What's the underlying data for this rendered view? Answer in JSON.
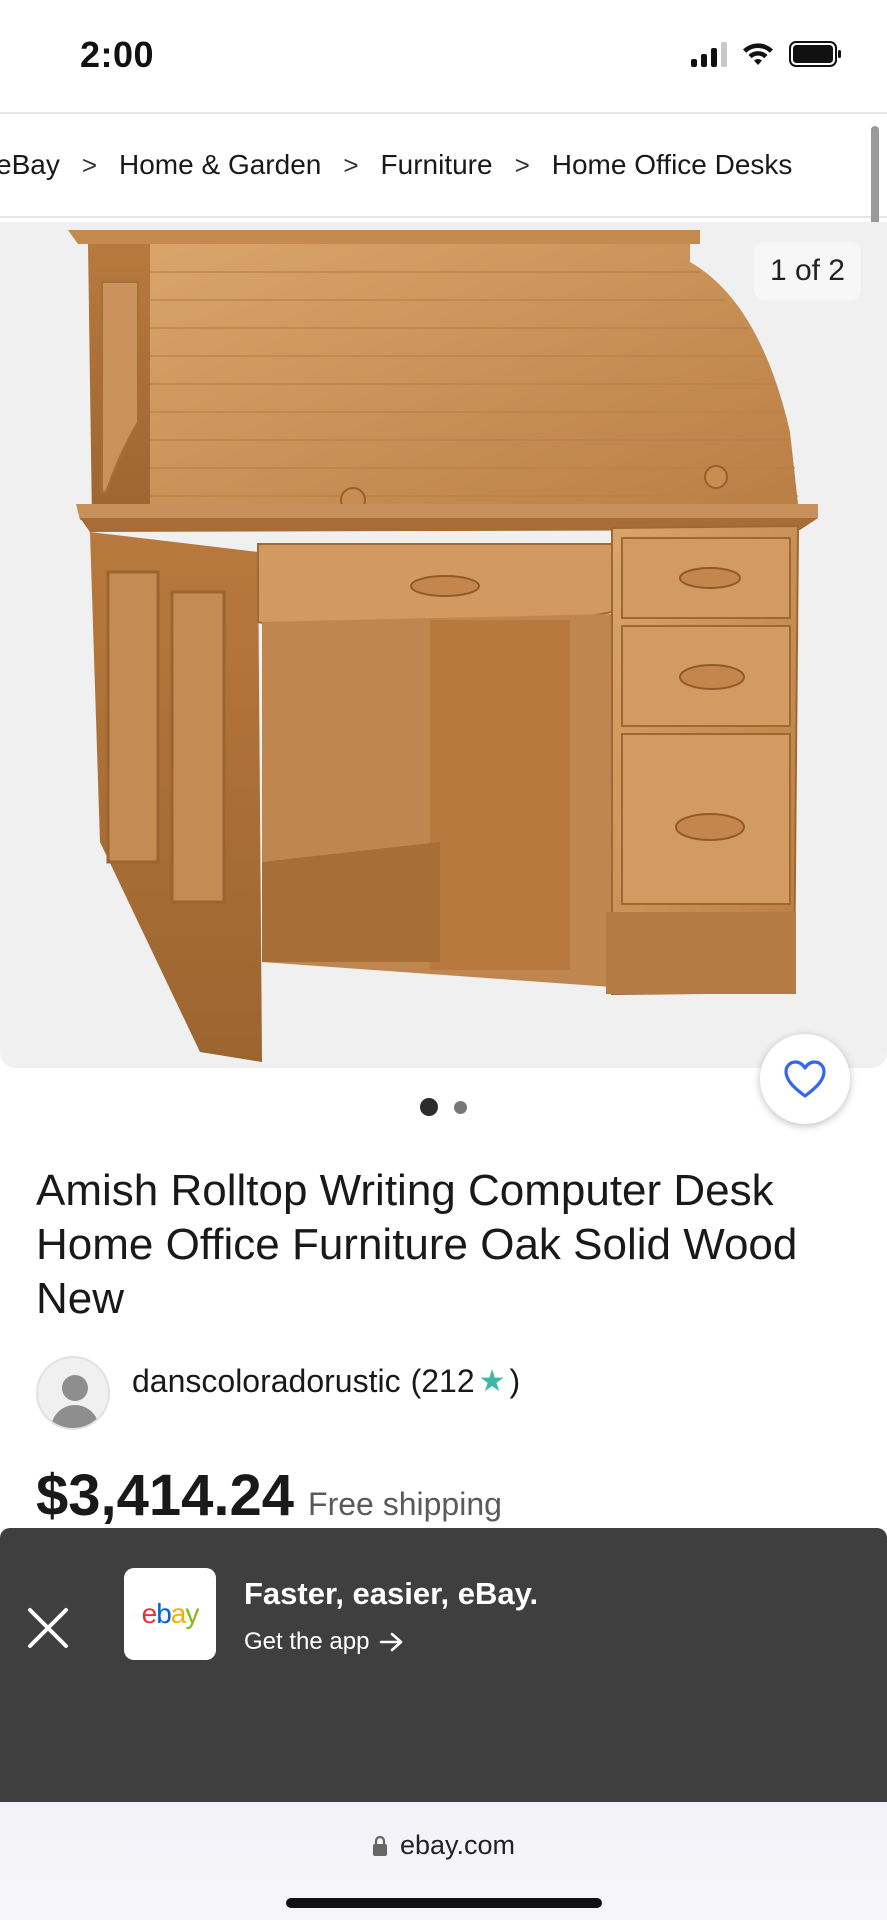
{
  "status_bar": {
    "time": "2:00"
  },
  "breadcrumb": {
    "items": [
      "eBay",
      "Home & Garden",
      "Furniture",
      "Home Office Desks"
    ],
    "separator": ">"
  },
  "gallery": {
    "counter": "1 of 2",
    "image_alt": "Oak rolltop desk",
    "current_index": 1,
    "total": 2
  },
  "listing": {
    "title": "Amish Rolltop Writing Computer Desk Home Office Furniture Oak Solid Wood New",
    "seller_name": "danscoloradorustic",
    "feedback_open": "(212",
    "feedback_close": ")",
    "price": "$3,414.24",
    "shipping": "Free shipping"
  },
  "app_banner": {
    "logo_text": [
      "e",
      "b",
      "a",
      "y"
    ],
    "title": "Faster, easier, eBay.",
    "link": "Get the app"
  },
  "url_bar": {
    "domain": "ebay.com"
  },
  "colors": {
    "logo_e": "#e53238",
    "logo_b": "#0064d2",
    "logo_a": "#f5af02",
    "logo_y": "#86b817",
    "star": "#3fb7a7",
    "banner_bg": "#3f3f3f"
  },
  "icons": {
    "signal": "signal-icon",
    "wifi": "wifi-icon",
    "battery": "battery-icon",
    "heart": "heart-icon",
    "close": "close-icon",
    "arrow": "arrow-right-icon",
    "lock": "lock-icon",
    "star": "star-icon"
  }
}
